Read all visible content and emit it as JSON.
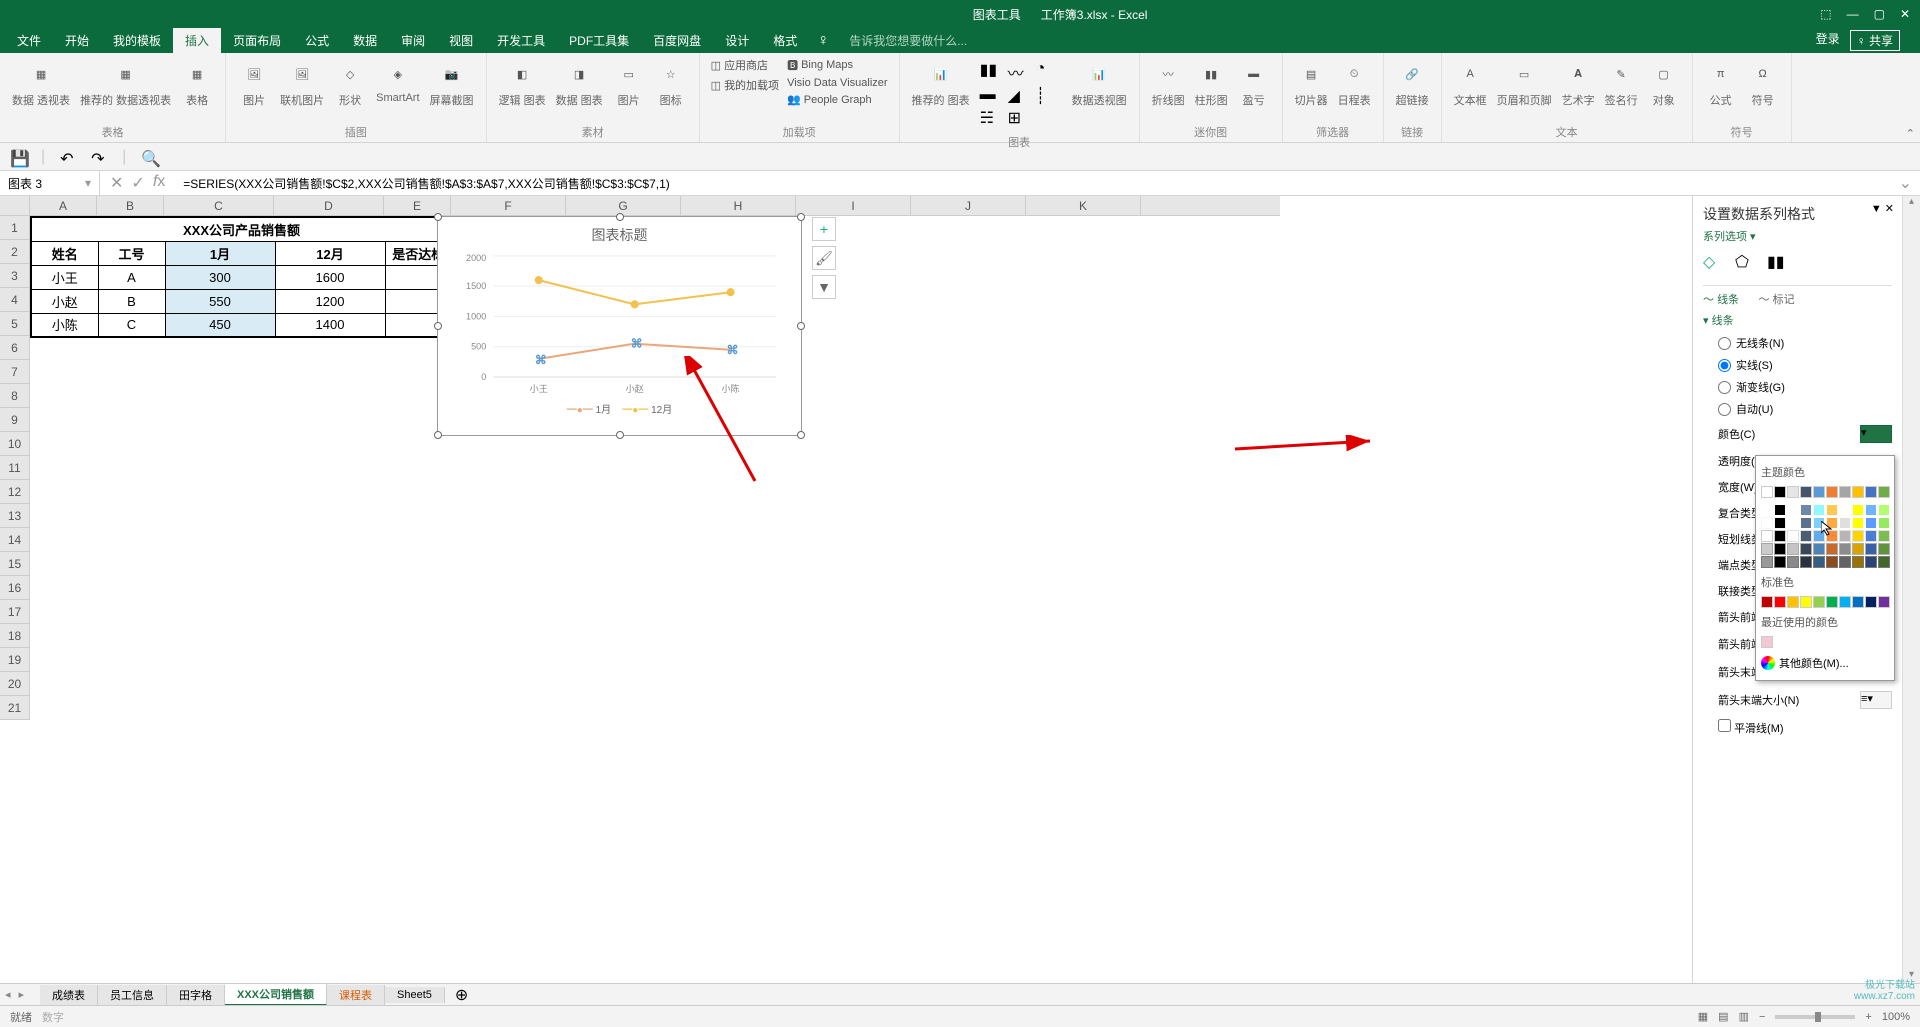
{
  "title_bar": {
    "chart_tools": "图表工具",
    "filename": "工作簿3.xlsx - Excel"
  },
  "menu": {
    "file": "文件",
    "home": "开始",
    "templates": "我的模板",
    "insert": "插入",
    "page_layout": "页面布局",
    "formulas": "公式",
    "data": "数据",
    "review": "审阅",
    "view": "视图",
    "dev": "开发工具",
    "pdf": "PDF工具集",
    "baidu": "百度网盘",
    "design": "设计",
    "format": "格式",
    "tell_me": "告诉我您想要做什么...",
    "login": "登录",
    "share": "共享"
  },
  "ribbon": {
    "pivot_table": "数据\n透视表",
    "recommended_pivot": "推荐的\n数据透视表",
    "table": "表格",
    "pictures": "图片",
    "online_pictures": "联机图片",
    "shapes": "形状",
    "smartart": "SmartArt",
    "screenshot": "屏幕截图",
    "illustrations": "插图",
    "logic_chart": "逻辑\n图表",
    "data_chart": "数据\n图表",
    "template": "图片",
    "icon": "图标",
    "material": "素材",
    "app_store": "应用商店",
    "my_addins": "我的加载项",
    "bing_maps": "Bing Maps",
    "visio": "Visio Data\nVisualizer",
    "people_graph": "People Graph",
    "addins": "加载项",
    "recommended_chart": "推荐的\n图表",
    "pivot_chart": "数据透视图",
    "charts": "图表",
    "sparkline_line": "折线图",
    "sparkline_col": "柱形图",
    "sparkline_wl": "盈亏",
    "sparklines": "迷你图",
    "slicer": "切片器",
    "timeline": "日程表",
    "filters": "筛选器",
    "hyperlink": "超链接",
    "links": "链接",
    "textbox": "文本框",
    "header_footer": "页眉和页脚",
    "wordart": "艺术字",
    "signature": "签名行",
    "object": "对象",
    "text": "文本",
    "equation": "公式",
    "symbol": "符号",
    "symbols": "符号"
  },
  "name_box": "图表 3",
  "formula": "=SERIES(XXX公司销售额!$C$2,XXX公司销售额!$A$3:$A$7,XXX公司销售额!$C$3:$C$7,1)",
  "columns": [
    "A",
    "B",
    "C",
    "D",
    "E",
    "F",
    "G",
    "H",
    "I",
    "J",
    "K"
  ],
  "table": {
    "title": "XXX公司产品销售额",
    "headers": [
      "姓名",
      "工号",
      "1月",
      "12月",
      "是否达标"
    ],
    "rows": [
      [
        "小王",
        "A",
        "300",
        "1600",
        ""
      ],
      [
        "小赵",
        "B",
        "550",
        "1200",
        ""
      ],
      [
        "小陈",
        "C",
        "450",
        "1400",
        ""
      ]
    ]
  },
  "chart_data": {
    "type": "line",
    "title": "图表标题",
    "categories": [
      "小王",
      "小赵",
      "小陈"
    ],
    "series": [
      {
        "name": "1月",
        "values": [
          300,
          550,
          450
        ],
        "color": "#e8a87c"
      },
      {
        "name": "12月",
        "values": [
          1600,
          1200,
          1400
        ],
        "color": "#f2c14e"
      }
    ],
    "ylim": [
      0,
      2000
    ],
    "yticks": [
      0,
      500,
      1000,
      1500,
      2000
    ]
  },
  "panel": {
    "title": "设置数据系列格式",
    "series_opts": "系列选项",
    "tab_line": "线条",
    "tab_marker": "标记",
    "section_line": "线条",
    "no_line": "无线条(N)",
    "solid": "实线(S)",
    "gradient": "渐变线(G)",
    "auto": "自动(U)",
    "color": "颜色(C)",
    "transparency": "透明度(T)",
    "width": "宽度(W)",
    "compound": "复合类型(C)",
    "dash": "短划线类型(D)",
    "cap": "端点类型(A)",
    "join": "联接类型(J)",
    "arrow_begin_type": "箭头前端类型",
    "arrow_begin_size": "箭头前端大小(S)",
    "arrow_end_type": "箭头末端类型(E)",
    "arrow_end_size": "箭头末端大小(N)",
    "smooth": "平滑线(M)"
  },
  "color_picker": {
    "theme": "主题颜色",
    "standard": "标准色",
    "recent": "最近使用的颜色",
    "more": "其他颜色(M)..."
  },
  "sheets": {
    "s1": "成绩表",
    "s2": "员工信息",
    "s3": "田字格",
    "s4": "XXX公司销售额",
    "s5": "课程表",
    "s6": "Sheet5"
  },
  "status": {
    "ready": "就绪",
    "zoom": "100%"
  },
  "watermark": "极光下载站\nwww.xz7.com"
}
